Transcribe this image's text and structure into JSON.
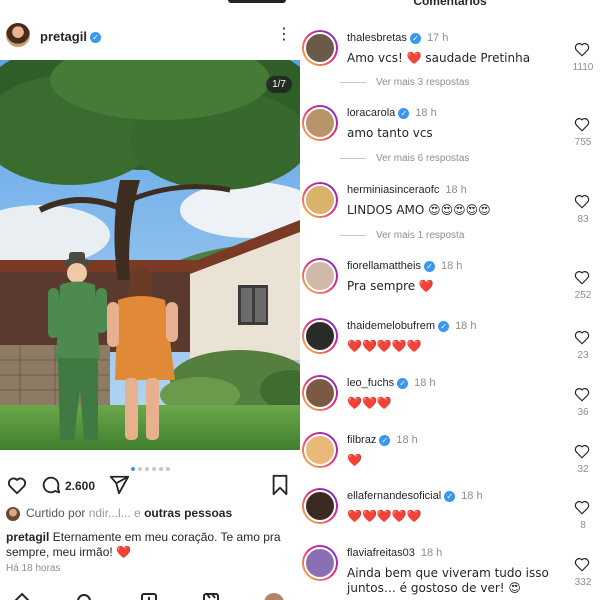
{
  "post": {
    "username": "pretagil",
    "slide_counter": "1/7",
    "comment_count": "2.600",
    "liked_by_prefix": "Curtido por",
    "liked_by_obscured": " ndir...l... e ",
    "liked_by_suffix": "outras pessoas",
    "caption_user": "pretagil",
    "caption_text": "Eternamente em meu coração. Te amo pra sempre, meu irmão! ❤️",
    "time_ago": "Há 18 horas",
    "slide_dots": 6,
    "active_dot": 0
  },
  "comments_panel": {
    "title": "Comentários",
    "comments": [
      {
        "user": "thalesbretas",
        "verified": true,
        "time": "17 h",
        "text": "Amo vcs! ❤️ saudade Pretinha",
        "likes": "1110",
        "replies": "Ver mais 3 respostas",
        "avatar_color": "#6b5a4a"
      },
      {
        "user": "loracarola",
        "verified": true,
        "time": "18 h",
        "text": "amo tanto vcs",
        "likes": "755",
        "replies": "Ver mais 6 respostas",
        "avatar_color": "#b8946a"
      },
      {
        "user": "herminiasinceraofc",
        "verified": false,
        "time": "18 h",
        "text": "LINDOS AMO 😍😍😍😍😍",
        "likes": "83",
        "replies": "Ver mais 1 resposta",
        "avatar_color": "#d9b36b"
      },
      {
        "user": "fiorellamattheis",
        "verified": true,
        "time": "18 h",
        "text": "Pra sempre ❤️",
        "likes": "252",
        "replies": "",
        "avatar_color": "#d1b9a8"
      },
      {
        "user": "thaidemelobufrem",
        "verified": true,
        "time": "18 h",
        "text": "❤️❤️❤️❤️❤️",
        "likes": "23",
        "replies": "",
        "avatar_color": "#2b2b2b"
      },
      {
        "user": "leo_fuchs",
        "verified": true,
        "time": "18 h",
        "text": "❤️❤️❤️",
        "likes": "36",
        "replies": "",
        "avatar_color": "#7a5a44"
      },
      {
        "user": "filbraz",
        "verified": true,
        "time": "18 h",
        "text": "❤️",
        "likes": "32",
        "replies": "",
        "avatar_color": "#e8b97a"
      },
      {
        "user": "ellafernandesoficial",
        "verified": true,
        "time": "18 h",
        "text": "❤️❤️❤️❤️❤️",
        "likes": "8",
        "replies": "",
        "avatar_color": "#3a2a22"
      },
      {
        "user": "flaviafreitas03",
        "verified": false,
        "time": "18 h",
        "text": "Ainda bem que viveram tudo isso juntos… é gostoso de ver! 😍",
        "likes": "332",
        "replies": "",
        "avatar_color": "#8a6fb5"
      }
    ]
  },
  "colors": {
    "verified": "#3897f0",
    "heart": "#ed4956",
    "muted": "#8e8e8e",
    "text": "#262626"
  },
  "icons": [
    "more-options-icon",
    "heart-icon",
    "comment-icon",
    "share-icon",
    "bookmark-icon",
    "home-icon",
    "search-icon",
    "add-post-icon",
    "reels-icon",
    "profile-avatar-icon"
  ]
}
